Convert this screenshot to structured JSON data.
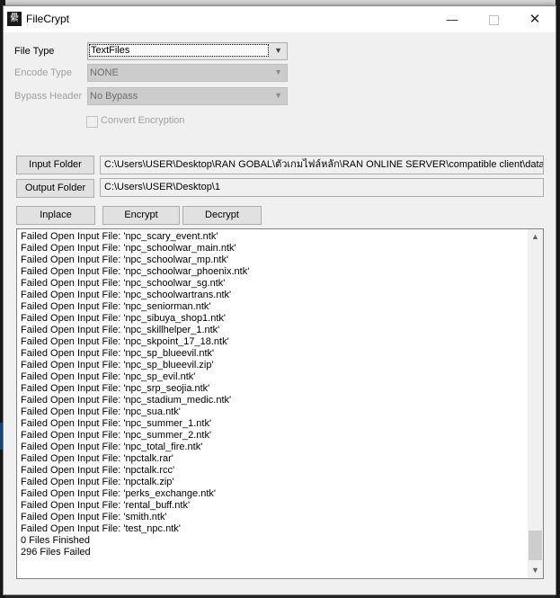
{
  "window": {
    "title": "FileCrypt",
    "icon_glyph": "纍",
    "minimize": "—",
    "close": "✕"
  },
  "form": {
    "file_type_label": "File Type",
    "file_type_value": "TextFiles",
    "encode_type_label": "Encode Type",
    "encode_type_value": "NONE",
    "bypass_header_label": "Bypass Header",
    "bypass_header_value": "No Bypass",
    "convert_encryption_label": "Convert Encryption",
    "convert_encryption_checked": false
  },
  "folders": {
    "input_button": "Input Folder",
    "input_path": "C:\\Users\\USER\\Desktop\\RAN GOBAL\\ตัวเกมไฟล์หลัก\\RAN ONLINE SERVER\\compatible client\\data\\glogic\\npctalk",
    "output_button": "Output Folder",
    "output_path": "C:\\Users\\USER\\Desktop\\1"
  },
  "actions": {
    "inplace": "Inplace",
    "encrypt": "Encrypt",
    "decrypt": "Decrypt"
  },
  "log": {
    "lines": [
      "Failed Open Input File: 'npc_scary_event.ntk'",
      "Failed Open Input File: 'npc_schoolwar_main.ntk'",
      "Failed Open Input File: 'npc_schoolwar_mp.ntk'",
      "Failed Open Input File: 'npc_schoolwar_phoenix.ntk'",
      "Failed Open Input File: 'npc_schoolwar_sg.ntk'",
      "Failed Open Input File: 'npc_schoolwartrans.ntk'",
      "Failed Open Input File: 'npc_seniorman.ntk'",
      "Failed Open Input File: 'npc_sibuya_shop1.ntk'",
      "Failed Open Input File: 'npc_skillhelper_1.ntk'",
      "Failed Open Input File: 'npc_skpoint_17_18.ntk'",
      "Failed Open Input File: 'npc_sp_blueevil.ntk'",
      "Failed Open Input File: 'npc_sp_blueevil.zip'",
      "Failed Open Input File: 'npc_sp_evil.ntk'",
      "Failed Open Input File: 'npc_srp_seojia.ntk'",
      "Failed Open Input File: 'npc_stadium_medic.ntk'",
      "Failed Open Input File: 'npc_sua.ntk'",
      "Failed Open Input File: 'npc_summer_1.ntk'",
      "Failed Open Input File: 'npc_summer_2.ntk'",
      "Failed Open Input File: 'npc_total_fire.ntk'",
      "Failed Open Input File: 'npctalk.rar'",
      "Failed Open Input File: 'npctalk.rcc'",
      "Failed Open Input File: 'npctalk.zip'",
      "Failed Open Input File: 'perks_exchange.ntk'",
      "Failed Open Input File: 'rental_buff.ntk'",
      "Failed Open Input File: 'smith.ntk'",
      "Failed Open Input File: 'test_npc.ntk'",
      "0 Files Finished",
      "296 Files Failed"
    ]
  }
}
